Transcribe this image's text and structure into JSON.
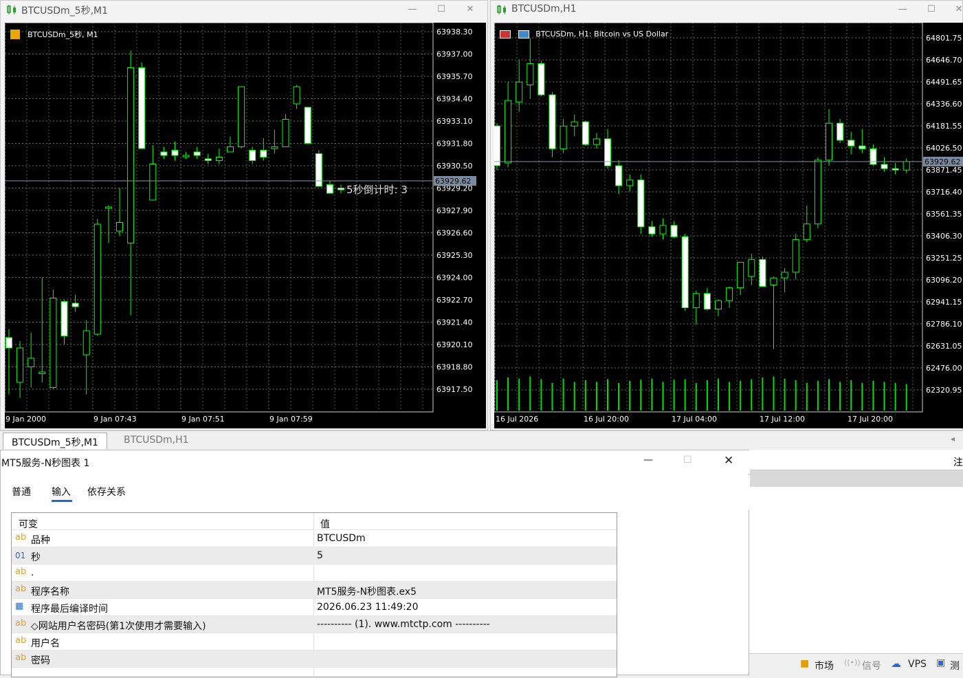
{
  "left_window": {
    "title": "BTCUSDm_5秒,M1",
    "chart_label": "BTCUSDm_5秒, M1",
    "countdown": "5秒倒计时: 3",
    "current_price": "63929.62",
    "price_levels": [
      "63938.30",
      "63937.00",
      "63935.70",
      "63934.40",
      "63933.10",
      "63931.80",
      "63930.50",
      "63929.20",
      "63927.90",
      "63926.60",
      "63925.30",
      "63924.00",
      "63922.70",
      "63921.40",
      "63920.10",
      "63918.80",
      "63917.50"
    ],
    "time_labels": [
      "9 Jan 2000",
      "9 Jan 07:43",
      "9 Jan 07:51",
      "9 Jan 07:59"
    ]
  },
  "right_window": {
    "title": "BTCUSDm,H1",
    "chart_label": "BTCUSDm, H1:  Bitcoin vs US Dollar",
    "current_price": "63929.62",
    "price_levels": [
      "64801.75",
      "64646.70",
      "64491.65",
      "64336.60",
      "64181.55",
      "64026.50",
      "63871.45",
      "63716.40",
      "63561.35",
      "63406.30",
      "63251.25",
      "63096.20",
      "62941.15",
      "62786.10",
      "62631.05",
      "62476.00",
      "62320.95"
    ],
    "time_labels": [
      "16 Jul 2026",
      "16 Jul 20:00",
      "17 Jul 04:00",
      "17 Jul 12:00",
      "17 Jul 20:00"
    ]
  },
  "chart_data": [
    {
      "type": "candlestick",
      "title": "BTCUSDm_5秒, M1",
      "ylim": [
        63917.5,
        63938.3
      ],
      "candles": [
        {
          "o": 63920.5,
          "h": 63921.0,
          "l": 63917.2,
          "c": 63919.9
        },
        {
          "o": 63917.9,
          "h": 63920.3,
          "l": 63917.0,
          "c": 63919.9
        },
        {
          "o": 63918.8,
          "h": 63920.8,
          "l": 63917.6,
          "c": 63919.3
        },
        {
          "o": 63918.4,
          "h": 63924.0,
          "l": 63917.9,
          "c": 63918.5
        },
        {
          "o": 63917.6,
          "h": 63923.3,
          "l": 63917.5,
          "c": 63922.8
        },
        {
          "o": 63922.6,
          "h": 63922.7,
          "l": 63920.1,
          "c": 63920.6
        },
        {
          "o": 63922.5,
          "h": 63923.0,
          "l": 63922.0,
          "c": 63922.3
        },
        {
          "o": 63919.5,
          "h": 63921.5,
          "l": 63917.2,
          "c": 63920.9
        },
        {
          "o": 63920.7,
          "h": 63927.4,
          "l": 63920.6,
          "c": 63927.1
        },
        {
          "o": 63928.1,
          "h": 63928.2,
          "l": 63926.0,
          "c": 63928.1
        },
        {
          "o": 63926.7,
          "h": 63929.2,
          "l": 63926.4,
          "c": 63927.2
        },
        {
          "o": 63926.0,
          "h": 63937.2,
          "l": 63921.8,
          "c": 63936.2
        },
        {
          "o": 63936.2,
          "h": 63936.5,
          "l": 63931.5,
          "c": 63931.5
        },
        {
          "o": 63928.5,
          "h": 63931.7,
          "l": 63928.5,
          "c": 63930.6
        },
        {
          "o": 63931.3,
          "h": 63931.6,
          "l": 63930.9,
          "c": 63931.1
        },
        {
          "o": 63931.4,
          "h": 63931.9,
          "l": 63930.8,
          "c": 63931.1
        },
        {
          "o": 63931.1,
          "h": 63931.3,
          "l": 63930.9,
          "c": 63931.1
        },
        {
          "o": 63931.3,
          "h": 63931.6,
          "l": 63930.9,
          "c": 63931.1
        },
        {
          "o": 63930.9,
          "h": 63931.2,
          "l": 63930.6,
          "c": 63930.8
        },
        {
          "o": 63930.8,
          "h": 63931.5,
          "l": 63930.6,
          "c": 63931.0
        },
        {
          "o": 63931.3,
          "h": 63932.2,
          "l": 63931.3,
          "c": 63931.6
        },
        {
          "o": 63931.6,
          "h": 63935.1,
          "l": 63931.5,
          "c": 63935.1
        },
        {
          "o": 63931.4,
          "h": 63931.6,
          "l": 63930.6,
          "c": 63930.8
        },
        {
          "o": 63931.4,
          "h": 63932.1,
          "l": 63930.8,
          "c": 63931.0
        },
        {
          "o": 63931.5,
          "h": 63932.6,
          "l": 63931.2,
          "c": 63931.6
        },
        {
          "o": 63931.6,
          "h": 63933.5,
          "l": 63931.6,
          "c": 63933.2
        },
        {
          "o": 63934.1,
          "h": 63935.2,
          "l": 63933.8,
          "c": 63935.1
        },
        {
          "o": 63933.9,
          "h": 63933.9,
          "l": 63931.8,
          "c": 63931.8
        },
        {
          "o": 63931.2,
          "h": 63931.4,
          "l": 63929.3,
          "c": 63929.3
        },
        {
          "o": 63929.4,
          "h": 63929.6,
          "l": 63928.9,
          "c": 63928.9
        },
        {
          "o": 63929.2,
          "h": 63929.4,
          "l": 63928.9,
          "c": 63929.1
        }
      ]
    },
    {
      "type": "candlestick",
      "title": "BTCUSDm, H1:  Bitcoin vs US Dollar",
      "ylim": [
        62320.95,
        64801.75
      ],
      "candles": [
        {
          "o": 64181.0,
          "h": 64201.0,
          "l": 63871.0,
          "c": 63901.0
        },
        {
          "o": 63920.0,
          "h": 64490.0,
          "l": 63890.0,
          "c": 64360.0
        },
        {
          "o": 64350.0,
          "h": 64645.0,
          "l": 64280.0,
          "c": 64490.0
        },
        {
          "o": 64470.0,
          "h": 64800.0,
          "l": 64370.0,
          "c": 64620.0
        },
        {
          "o": 64620.0,
          "h": 64640.0,
          "l": 64390.0,
          "c": 64400.0
        },
        {
          "o": 64400.0,
          "h": 64420.0,
          "l": 63960.0,
          "c": 64020.0
        },
        {
          "o": 64020.0,
          "h": 64230.0,
          "l": 63990.0,
          "c": 64180.0
        },
        {
          "o": 64180.0,
          "h": 64260.0,
          "l": 64110.0,
          "c": 64210.0
        },
        {
          "o": 64210.0,
          "h": 64220.0,
          "l": 64040.0,
          "c": 64050.0
        },
        {
          "o": 64050.0,
          "h": 64130.0,
          "l": 64020.0,
          "c": 64090.0
        },
        {
          "o": 64090.0,
          "h": 64160.0,
          "l": 63880.0,
          "c": 63900.0
        },
        {
          "o": 63900.0,
          "h": 63940.0,
          "l": 63700.0,
          "c": 63760.0
        },
        {
          "o": 63760.0,
          "h": 63840.0,
          "l": 63720.0,
          "c": 63800.0
        },
        {
          "o": 63800.0,
          "h": 63840.0,
          "l": 63420.0,
          "c": 63470.0
        },
        {
          "o": 63470.0,
          "h": 63510.0,
          "l": 63400.0,
          "c": 63420.0
        },
        {
          "o": 63420.0,
          "h": 63530.0,
          "l": 63380.0,
          "c": 63480.0
        },
        {
          "o": 63480.0,
          "h": 63510.0,
          "l": 63390.0,
          "c": 63400.0
        },
        {
          "o": 63400.0,
          "h": 63420.0,
          "l": 62880.0,
          "c": 62900.0
        },
        {
          "o": 62900.0,
          "h": 63020.0,
          "l": 62780.0,
          "c": 63000.0
        },
        {
          "o": 63000.0,
          "h": 63040.0,
          "l": 62880.0,
          "c": 62890.0
        },
        {
          "o": 62890.0,
          "h": 62960.0,
          "l": 62840.0,
          "c": 62950.0
        },
        {
          "o": 62950.0,
          "h": 63050.0,
          "l": 62900.0,
          "c": 63040.0
        },
        {
          "o": 63040.0,
          "h": 63200.0,
          "l": 62990.0,
          "c": 63220.0
        },
        {
          "o": 63120.0,
          "h": 63280.0,
          "l": 63060.0,
          "c": 63240.0
        },
        {
          "o": 63240.0,
          "h": 63260.0,
          "l": 63120.0,
          "c": 63050.0
        },
        {
          "o": 63060.0,
          "h": 63120.0,
          "l": 62610.0,
          "c": 63110.0
        },
        {
          "o": 63110.0,
          "h": 63180.0,
          "l": 63010.0,
          "c": 63150.0
        },
        {
          "o": 63150.0,
          "h": 63420.0,
          "l": 63100.0,
          "c": 63380.0
        },
        {
          "o": 63380.0,
          "h": 63620.0,
          "l": 63360.0,
          "c": 63490.0
        },
        {
          "o": 63490.0,
          "h": 63960.0,
          "l": 63460.0,
          "c": 63940.0
        },
        {
          "o": 63940.0,
          "h": 64300.0,
          "l": 63900.0,
          "c": 64200.0
        },
        {
          "o": 64200.0,
          "h": 64230.0,
          "l": 64060.0,
          "c": 64080.0
        },
        {
          "o": 64080.0,
          "h": 64140.0,
          "l": 63980.0,
          "c": 64040.0
        },
        {
          "o": 64040.0,
          "h": 64160.0,
          "l": 63990.0,
          "c": 64020.0
        },
        {
          "o": 64020.0,
          "h": 64050.0,
          "l": 63900.0,
          "c": 63910.0
        },
        {
          "o": 63910.0,
          "h": 63960.0,
          "l": 63860.0,
          "c": 63880.0
        },
        {
          "o": 63880.0,
          "h": 63920.0,
          "l": 63840.0,
          "c": 63870.0
        },
        {
          "o": 63870.0,
          "h": 63950.0,
          "l": 63850.0,
          "c": 63929.62
        }
      ],
      "volume": [
        55,
        60,
        58,
        62,
        57,
        50,
        58,
        52,
        55,
        52,
        57,
        50,
        54,
        56,
        58,
        52,
        56,
        57,
        50,
        55,
        58,
        52,
        54,
        57,
        60,
        62,
        58,
        55,
        50,
        54,
        57,
        52,
        55,
        50,
        54,
        52,
        50,
        48
      ]
    }
  ],
  "tabs": [
    {
      "label": "BTCUSDm_5秒,M1"
    },
    {
      "label": "BTCUSDm,H1"
    }
  ],
  "dialog": {
    "title": "MT5服务-N秒图表 1",
    "tabs": [
      "普通",
      "输入",
      "依存关系"
    ],
    "header_col1": "可变",
    "header_col2": "值",
    "rows": [
      {
        "type": "ab",
        "name": "品种",
        "value": "BTCUSDm"
      },
      {
        "type": "01",
        "name": "秒",
        "value": "5"
      },
      {
        "type": "ab",
        "name": ".",
        "value": ""
      },
      {
        "type": "ab",
        "name": "程序名称",
        "value": "MT5服务-N秒图表.ex5"
      },
      {
        "type": "cal",
        "name": "程序最后编译时间",
        "value": "2026.06.23 11:49:20"
      },
      {
        "type": "ab",
        "name": "◇网站用户名密码(第1次使用才需要输入)",
        "value": "---------- (1). www.mtctp.com ----------"
      },
      {
        "type": "ab",
        "name": "用户名",
        "value": ""
      },
      {
        "type": "ab",
        "name": "密码",
        "value": ""
      }
    ]
  },
  "right_pane": {
    "partial_label": "注"
  },
  "status_bar": {
    "market": "市场",
    "signal": "信号",
    "vps": "VPS",
    "test": "测"
  },
  "colors": {
    "bull_fill": "#ffffff",
    "bear_fill": "#000000",
    "candle_outline": "#00ff00",
    "grid": "#6b6b6b",
    "bg": "#000000"
  }
}
